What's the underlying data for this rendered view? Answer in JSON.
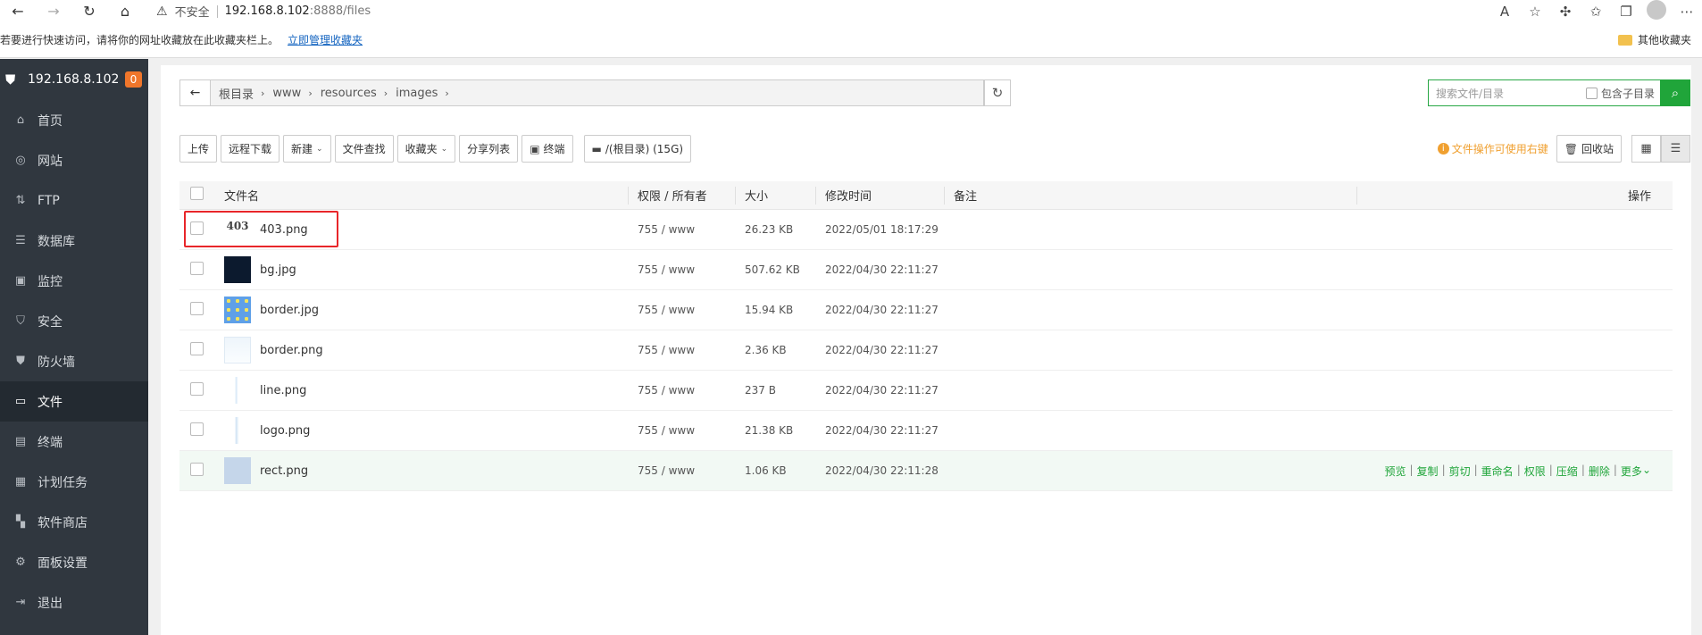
{
  "browser": {
    "security_label": "不安全",
    "url_host": "192.168.8.102",
    "url_rest": ":8888/files",
    "favorites_msg": "若要进行快速访问，请将你的网址收藏放在此收藏夹栏上。",
    "favorites_link": "立即管理收藏夹",
    "other_favorites": "其他收藏夹"
  },
  "sidebar": {
    "server": "192.168.8.102",
    "badge": "0",
    "items": [
      {
        "label": "首页",
        "icon": "home-icon",
        "glyph": "⌂"
      },
      {
        "label": "网站",
        "icon": "globe-icon",
        "glyph": "◎"
      },
      {
        "label": "FTP",
        "icon": "ftp-icon",
        "glyph": "⇅"
      },
      {
        "label": "数据库",
        "icon": "database-icon",
        "glyph": "☰"
      },
      {
        "label": "监控",
        "icon": "monitor-icon",
        "glyph": "▣"
      },
      {
        "label": "安全",
        "icon": "shield-check-icon",
        "glyph": "⛉"
      },
      {
        "label": "防火墙",
        "icon": "firewall-icon",
        "glyph": "⛊"
      },
      {
        "label": "文件",
        "icon": "folder-icon",
        "glyph": "▭"
      },
      {
        "label": "终端",
        "icon": "terminal-icon",
        "glyph": "▤"
      },
      {
        "label": "计划任务",
        "icon": "calendar-icon",
        "glyph": "▦"
      },
      {
        "label": "软件商店",
        "icon": "grid-icon",
        "glyph": "▚"
      },
      {
        "label": "面板设置",
        "icon": "settings-icon",
        "glyph": "⚙"
      },
      {
        "label": "退出",
        "icon": "logout-icon",
        "glyph": "⇥"
      }
    ],
    "active_index": 7
  },
  "breadcrumb": [
    "根目录",
    "www",
    "resources",
    "images"
  ],
  "search": {
    "placeholder": "搜索文件/目录",
    "subdir_label": "包含子目录"
  },
  "toolbar": {
    "upload": "上传",
    "remote_download": "远程下载",
    "new": "新建",
    "find": "文件查找",
    "favorites": "收藏夹",
    "share_list": "分享列表",
    "terminal": "终端",
    "disk": "/(根目录) (15G)",
    "tip": "文件操作可使用右键",
    "recycle": "回收站"
  },
  "table": {
    "headers": {
      "name": "文件名",
      "perm": "权限 / 所有者",
      "size": "大小",
      "mtime": "修改时间",
      "note": "备注",
      "ops": "操作"
    },
    "rows": [
      {
        "name": "403.png",
        "thumb": "t-403",
        "thumb_text": "403",
        "perm": "755 / www",
        "size": "26.23 KB",
        "mtime": "2022/05/01 18:17:29"
      },
      {
        "name": "bg.jpg",
        "thumb": "t-bg",
        "thumb_text": "",
        "perm": "755 / www",
        "size": "507.62 KB",
        "mtime": "2022/04/30 22:11:27"
      },
      {
        "name": "border.jpg",
        "thumb": "t-border",
        "thumb_text": "",
        "perm": "755 / www",
        "size": "15.94 KB",
        "mtime": "2022/04/30 22:11:27"
      },
      {
        "name": "border.png",
        "thumb": "t-borderpng",
        "thumb_text": "",
        "perm": "755 / www",
        "size": "2.36 KB",
        "mtime": "2022/04/30 22:11:27"
      },
      {
        "name": "line.png",
        "thumb": "t-line",
        "thumb_text": "",
        "perm": "755 / www",
        "size": "237 B",
        "mtime": "2022/04/30 22:11:27"
      },
      {
        "name": "logo.png",
        "thumb": "t-logo",
        "thumb_text": "",
        "perm": "755 / www",
        "size": "21.38 KB",
        "mtime": "2022/04/30 22:11:27"
      },
      {
        "name": "rect.png",
        "thumb": "t-rect",
        "thumb_text": "",
        "perm": "755 / www",
        "size": "1.06 KB",
        "mtime": "2022/04/30 22:11:28"
      }
    ],
    "hover_row": 6,
    "row_ops": [
      "预览",
      "复制",
      "剪切",
      "重命名",
      "权限",
      "压缩",
      "删除",
      "更多"
    ]
  }
}
